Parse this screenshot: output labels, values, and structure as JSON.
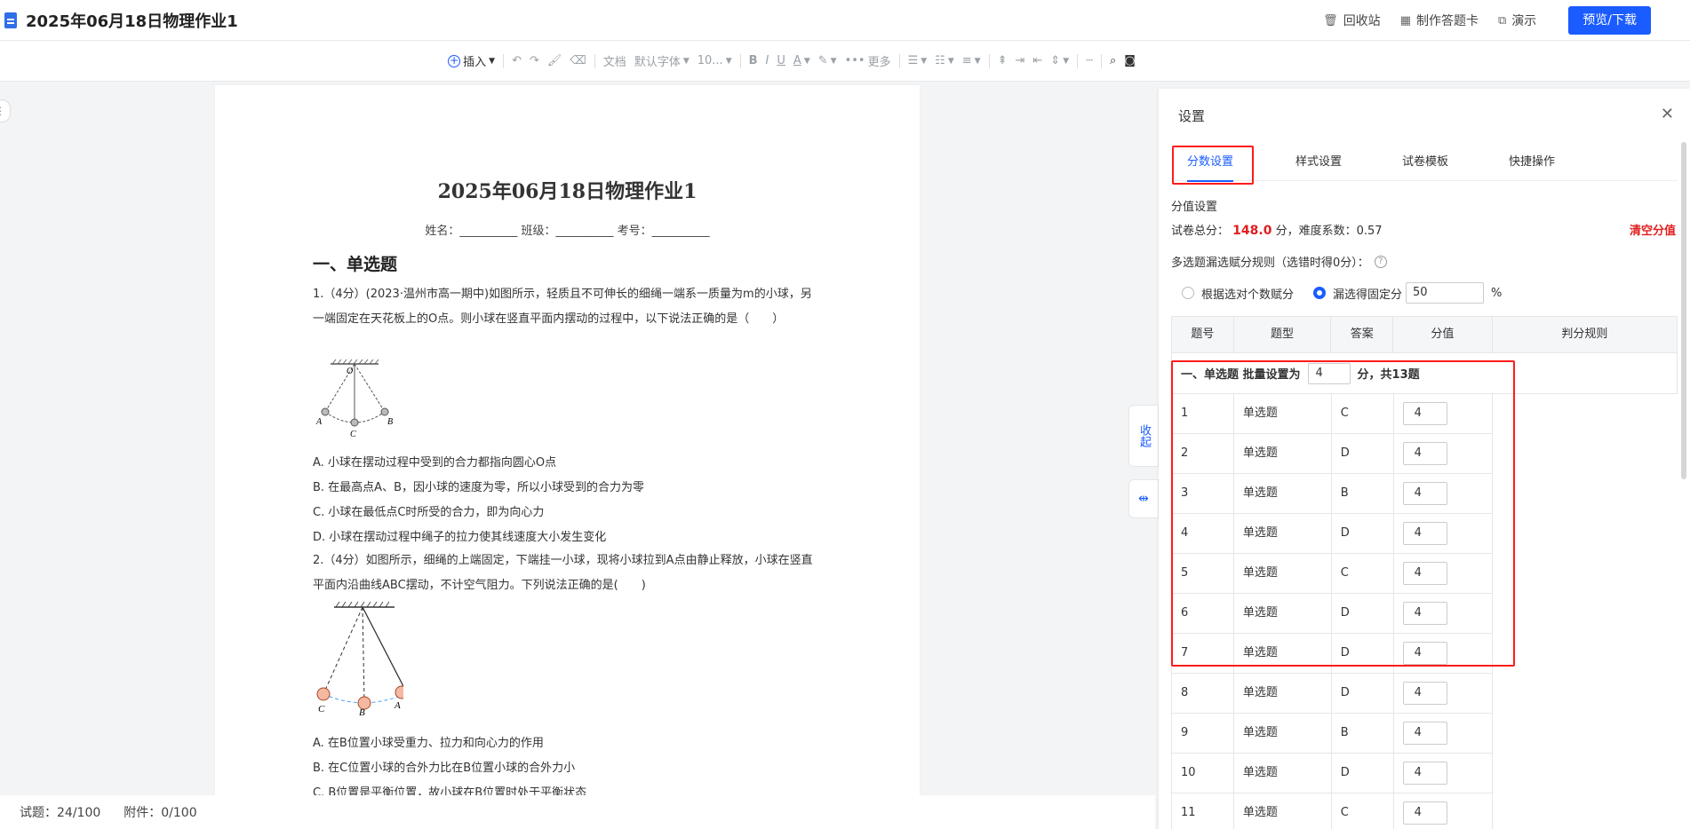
{
  "header": {
    "title": "2025年06月18日物理作业1",
    "actions": [
      {
        "label": "回收站",
        "icon": "trash-icon"
      },
      {
        "label": "制作答题卡",
        "icon": "card-icon"
      },
      {
        "label": "演示",
        "icon": "present-icon"
      }
    ],
    "primary": "预览/下载"
  },
  "toolbar": {
    "insert": "插入",
    "style": "文档",
    "font": "默认字体",
    "size": "10...",
    "more": "更多"
  },
  "paper": {
    "title": "2025年06月18日物理作业1",
    "meta": "姓名：__________ 班级：__________ 考号：__________",
    "section": "一、单选题",
    "q1": "1.（4分）(2023·温州市高一期中)如图所示，轻质且不可伸长的细绳一端系一质量为m的小球，另一端固定在天花板上的O点。则小球在竖直平面内摆动的过程中，以下说法正确的是（　　）",
    "q1_opts": [
      "A. 小球在摆动过程中受到的合力都指向圆心O点",
      "B. 在最高点A、B，因小球的速度为零，所以小球受到的合力为零",
      "C. 小球在最低点C时所受的合力，即为向心力",
      "D. 小球在摆动过程中绳子的拉力使其线速度大小发生变化"
    ],
    "q2": "2.（4分）如图所示，细绳的上端固定，下端挂一小球，现将小球拉到A点由静止释放，小球在竖直平面内沿曲线ABC摆动，不计空气阻力。下列说法正确的是(　　)",
    "q2_opts": [
      "A. 在B位置小球受重力、拉力和向心力的作用",
      "B. 在C位置小球的合外力比在B位置小球的合外力小",
      "C. B位置是平衡位置，故小球在B位置时处于平衡状态"
    ],
    "fig1_labels": {
      "o": "O",
      "a": "A",
      "c": "C",
      "b": "B"
    },
    "fig2_labels": {
      "c": "C",
      "b": "B",
      "a": "A"
    }
  },
  "statusbar": {
    "questions": "试题：24/100",
    "attachments": "附件：0/100"
  },
  "side_tabs": {
    "collapse": "收起"
  },
  "panel": {
    "title": "设置",
    "tabs": [
      "分数设置",
      "样式设置",
      "试卷模板",
      "快捷操作"
    ],
    "score_section": "分值设置",
    "total_prefix": "试卷总分：",
    "total_value": "148.0",
    "total_suffix": "分，难度系数：0.57",
    "clear": "清空分值",
    "rule_label": "多选题漏选赋分规则（选错时得0分）：",
    "radio1": "根据选对个数赋分",
    "radio2": "漏选得固定分",
    "pct_value": "50",
    "pct_unit": "%",
    "table_headers": [
      "题号",
      "题型",
      "答案",
      "分值",
      "判分规则"
    ],
    "group": {
      "prefix": "一、单选题 批量设置为",
      "value": "4",
      "suffix": "分，共13题"
    },
    "rows": [
      {
        "no": "1",
        "type": "单选题",
        "answer": "C",
        "score": "4"
      },
      {
        "no": "2",
        "type": "单选题",
        "answer": "D",
        "score": "4"
      },
      {
        "no": "3",
        "type": "单选题",
        "answer": "B",
        "score": "4"
      },
      {
        "no": "4",
        "type": "单选题",
        "answer": "D",
        "score": "4"
      },
      {
        "no": "5",
        "type": "单选题",
        "answer": "C",
        "score": "4"
      },
      {
        "no": "6",
        "type": "单选题",
        "answer": "D",
        "score": "4"
      },
      {
        "no": "7",
        "type": "单选题",
        "answer": "D",
        "score": "4"
      },
      {
        "no": "8",
        "type": "单选题",
        "answer": "D",
        "score": "4"
      },
      {
        "no": "9",
        "type": "单选题",
        "answer": "B",
        "score": "4"
      },
      {
        "no": "10",
        "type": "单选题",
        "answer": "D",
        "score": "4"
      },
      {
        "no": "11",
        "type": "单选题",
        "answer": "C",
        "score": "4"
      }
    ]
  },
  "colors": {
    "accent": "#1a5cff",
    "highlight": "#ff1a1a",
    "danger": "#e01e1e"
  }
}
